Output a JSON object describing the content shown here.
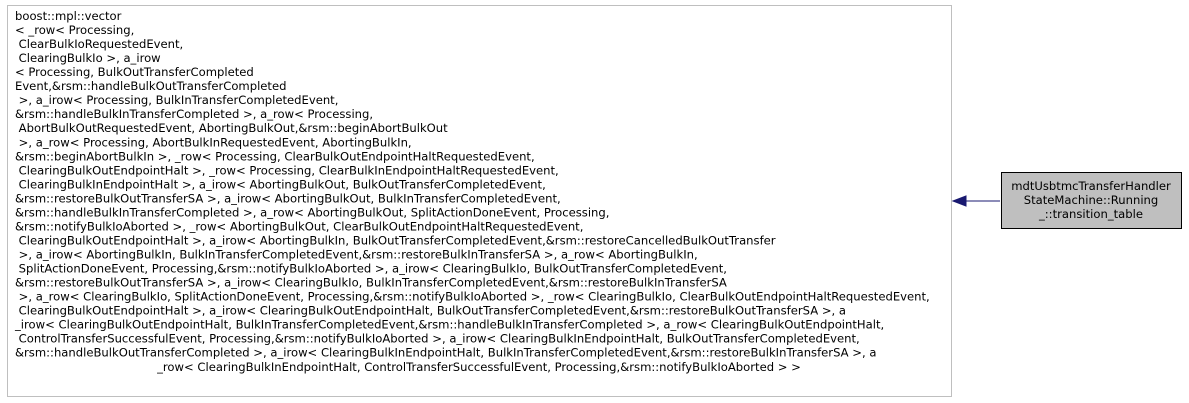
{
  "base_class": {
    "lines": [
      "boost::mpl::vector",
      "< _row< Processing,",
      " ClearBulkIoRequestedEvent,",
      " ClearingBulkIo >, a_irow",
      "< Processing, BulkOutTransferCompleted",
      "Event,&rsm::handleBulkOutTransferCompleted",
      " >, a_irow< Processing, BulkInTransferCompletedEvent,",
      "&rsm::handleBulkInTransferCompleted >, a_row< Processing,",
      " AbortBulkOutRequestedEvent, AbortingBulkOut,&rsm::beginAbortBulkOut",
      " >, a_row< Processing, AbortBulkInRequestedEvent, AbortingBulkIn,",
      "&rsm::beginAbortBulkIn >, _row< Processing, ClearBulkOutEndpointHaltRequestedEvent,",
      " ClearingBulkOutEndpointHalt >, _row< Processing, ClearBulkInEndpointHaltRequestedEvent,",
      " ClearingBulkInEndpointHalt >, a_irow< AbortingBulkOut, BulkOutTransferCompletedEvent,",
      "&rsm::restoreBulkOutTransferSA >, a_irow< AbortingBulkOut, BulkInTransferCompletedEvent,",
      "&rsm::handleBulkInTransferCompleted >, a_row< AbortingBulkOut, SplitActionDoneEvent, Processing,",
      "&rsm::notifyBulkIoAborted >, _row< AbortingBulkOut, ClearBulkOutEndpointHaltRequestedEvent,",
      " ClearingBulkOutEndpointHalt >, a_irow< AbortingBulkIn, BulkOutTransferCompletedEvent,&rsm::restoreCancelledBulkOutTransfer",
      " >, a_irow< AbortingBulkIn, BulkInTransferCompletedEvent,&rsm::restoreBulkInTransferSA >, a_row< AbortingBulkIn,",
      " SplitActionDoneEvent, Processing,&rsm::notifyBulkIoAborted >, a_irow< ClearingBulkIo, BulkOutTransferCompletedEvent,",
      "&rsm::restoreBulkOutTransferSA >, a_irow< ClearingBulkIo, BulkInTransferCompletedEvent,&rsm::restoreBulkInTransferSA",
      " >, a_row< ClearingBulkIo, SplitActionDoneEvent, Processing,&rsm::notifyBulkIoAborted >, _row< ClearingBulkIo, ClearBulkOutEndpointHaltRequestedEvent,",
      " ClearingBulkOutEndpointHalt >, a_irow< ClearingBulkOutEndpointHalt, BulkOutTransferCompletedEvent,&rsm::restoreBulkOutTransferSA >, a",
      "_irow< ClearingBulkOutEndpointHalt, BulkInTransferCompletedEvent,&rsm::handleBulkInTransferCompleted >, a_row< ClearingBulkOutEndpointHalt,",
      " ControlTransferSuccessfulEvent, Processing,&rsm::notifyBulkIoAborted >, a_irow< ClearingBulkInEndpointHalt, BulkOutTransferCompletedEvent,",
      "&rsm::handleBulkOutTransferCompleted >, a_irow< ClearingBulkInEndpointHalt, BulkInTransferCompletedEvent,&rsm::restoreBulkInTransferSA >, a",
      "_row< ClearingBulkInEndpointHalt, ControlTransferSuccessfulEvent, Processing,&rsm::notifyBulkIoAborted > >"
    ]
  },
  "derived_class": {
    "lines": [
      "mdtUsbtmcTransferHandler",
      "StateMachine::Running",
      "_::transition_table"
    ]
  },
  "colors": {
    "base_border": "#bfbfbf",
    "base_fill": "#ffffff",
    "derived_border": "#000000",
    "derived_fill": "#bfbfbf",
    "arrow": "#191970",
    "text": "#000000"
  }
}
